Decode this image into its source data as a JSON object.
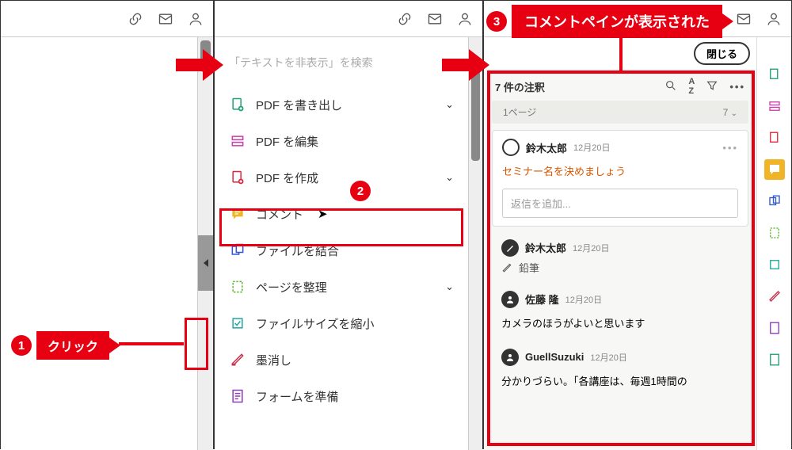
{
  "callouts": {
    "c1_num": "1",
    "c1_label": "クリック",
    "c2_num": "2",
    "c3_num": "3",
    "c3_label": "コメントペインが表示された"
  },
  "panel2": {
    "search_placeholder": "「テキストを非表示」を検索",
    "tools": {
      "export": "PDF を書き出し",
      "edit": "PDF を編集",
      "create": "PDF を作成",
      "comment": "コメント",
      "combine": "ファイルを結合",
      "organize": "ページを整理",
      "optimize": "ファイルサイズを縮小",
      "redact": "墨消し",
      "form": "フォームを準備"
    }
  },
  "panel3": {
    "close": "閉じる",
    "count_label": "7 件の注釈",
    "page_label": "1ページ",
    "page_count": "7",
    "comments": [
      {
        "name": "鈴木太郎",
        "date": "12月20日",
        "body": "セミナー名を決めましょう",
        "reply_placeholder": "返信を追加..."
      },
      {
        "name": "鈴木太郎",
        "date": "12月20日",
        "tool": "鉛筆"
      },
      {
        "name": "佐藤 隆",
        "date": "12月20日",
        "body": "カメラのほうがよいと思います"
      },
      {
        "name": "GuellSuzuki",
        "date": "12月20日",
        "body": "分かりづらい。「各講座は、毎週1時間の"
      }
    ]
  }
}
